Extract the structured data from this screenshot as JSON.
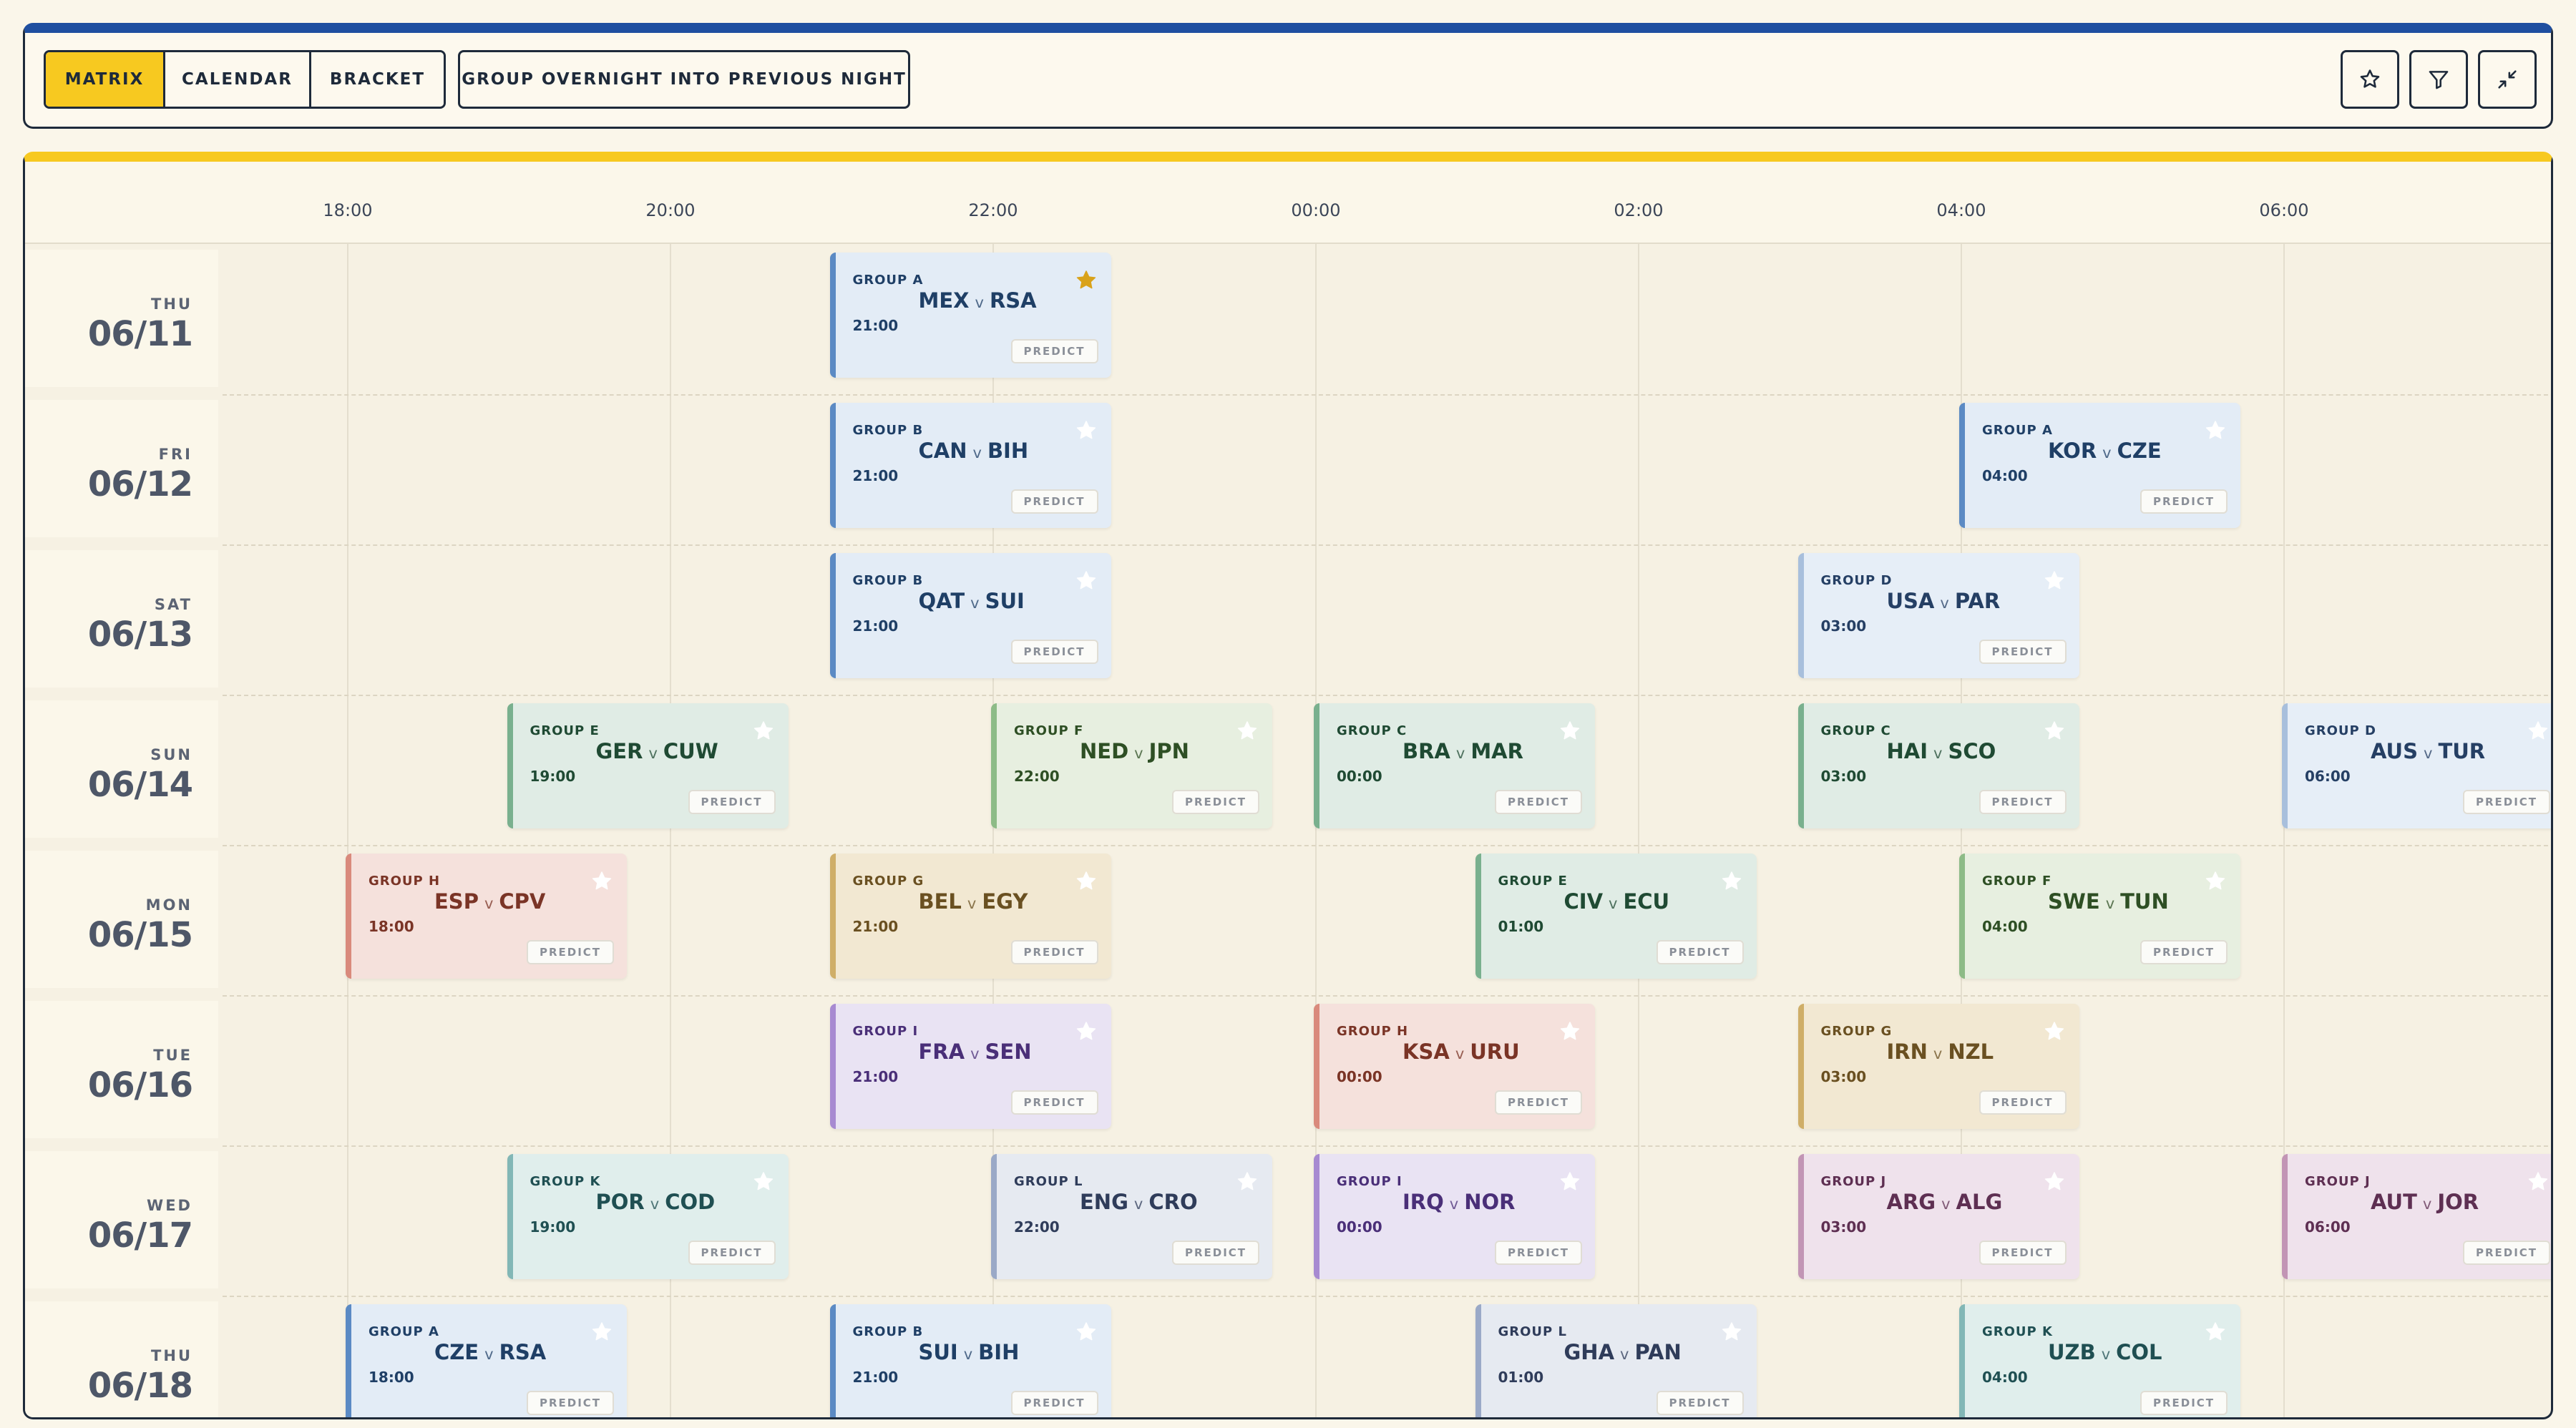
{
  "toolbar": {
    "views": [
      "MATRIX",
      "CALENDAR",
      "BRACKET"
    ],
    "active_view": "MATRIX",
    "group_overnight_label": "GROUP OVERNIGHT INTO PREVIOUS NIGHT",
    "icons": [
      "star-icon",
      "filter-icon",
      "collapse-icon"
    ],
    "colors": {
      "active": "#f7c920",
      "top_accent": "#1f4fa0",
      "panel_accent": "#f7c920"
    }
  },
  "matrix": {
    "time_ticks": [
      "18:00",
      "20:00",
      "22:00",
      "00:00",
      "02:00",
      "04:00",
      "06:00"
    ],
    "days": [
      {
        "dow": "THU",
        "date": "06/11"
      },
      {
        "dow": "FRI",
        "date": "06/12"
      },
      {
        "dow": "SAT",
        "date": "06/13"
      },
      {
        "dow": "SUN",
        "date": "06/14"
      },
      {
        "dow": "MON",
        "date": "06/15"
      },
      {
        "dow": "TUE",
        "date": "06/16"
      },
      {
        "dow": "WED",
        "date": "06/17"
      },
      {
        "dow": "THU",
        "date": "06/18"
      }
    ],
    "predict_label": "PREDICT",
    "vs_label": "v",
    "matches": [
      {
        "day": 0,
        "group": "GROUP A",
        "home": "MEX",
        "away": "RSA",
        "time": "21:00",
        "starred": true,
        "color": "blue"
      },
      {
        "day": 1,
        "group": "GROUP B",
        "home": "CAN",
        "away": "BIH",
        "time": "21:00",
        "starred": false,
        "color": "blue"
      },
      {
        "day": 1,
        "group": "GROUP A",
        "home": "KOR",
        "away": "CZE",
        "time": "04:00",
        "starred": false,
        "color": "blue"
      },
      {
        "day": 2,
        "group": "GROUP B",
        "home": "QAT",
        "away": "SUI",
        "time": "21:00",
        "starred": false,
        "color": "blue"
      },
      {
        "day": 2,
        "group": "GROUP D",
        "home": "USA",
        "away": "PAR",
        "time": "03:00",
        "starred": false,
        "color": "ice"
      },
      {
        "day": 3,
        "group": "GROUP E",
        "home": "GER",
        "away": "CUW",
        "time": "19:00",
        "starred": false,
        "color": "green"
      },
      {
        "day": 3,
        "group": "GROUP F",
        "home": "NED",
        "away": "JPN",
        "time": "22:00",
        "starred": false,
        "color": "lgreen"
      },
      {
        "day": 3,
        "group": "GROUP C",
        "home": "BRA",
        "away": "MAR",
        "time": "00:00",
        "starred": false,
        "color": "green"
      },
      {
        "day": 3,
        "group": "GROUP C",
        "home": "HAI",
        "away": "SCO",
        "time": "03:00",
        "starred": false,
        "color": "green"
      },
      {
        "day": 3,
        "group": "GROUP D",
        "home": "AUS",
        "away": "TUR",
        "time": "06:00",
        "starred": false,
        "color": "ice"
      },
      {
        "day": 4,
        "group": "GROUP H",
        "home": "ESP",
        "away": "CPV",
        "time": "18:00",
        "starred": false,
        "color": "red"
      },
      {
        "day": 4,
        "group": "GROUP G",
        "home": "BEL",
        "away": "EGY",
        "time": "21:00",
        "starred": false,
        "color": "gold"
      },
      {
        "day": 4,
        "group": "GROUP E",
        "home": "CIV",
        "away": "ECU",
        "time": "01:00",
        "starred": false,
        "color": "green"
      },
      {
        "day": 4,
        "group": "GROUP F",
        "home": "SWE",
        "away": "TUN",
        "time": "04:00",
        "starred": false,
        "color": "lgreen"
      },
      {
        "day": 5,
        "group": "GROUP I",
        "home": "FRA",
        "away": "SEN",
        "time": "21:00",
        "starred": false,
        "color": "purple"
      },
      {
        "day": 5,
        "group": "GROUP H",
        "home": "KSA",
        "away": "URU",
        "time": "00:00",
        "starred": false,
        "color": "red"
      },
      {
        "day": 5,
        "group": "GROUP G",
        "home": "IRN",
        "away": "NZL",
        "time": "03:00",
        "starred": false,
        "color": "gold"
      },
      {
        "day": 6,
        "group": "GROUP K",
        "home": "POR",
        "away": "COD",
        "time": "19:00",
        "starred": false,
        "color": "teal"
      },
      {
        "day": 6,
        "group": "GROUP L",
        "home": "ENG",
        "away": "CRO",
        "time": "22:00",
        "starred": false,
        "color": "slate"
      },
      {
        "day": 6,
        "group": "GROUP I",
        "home": "IRQ",
        "away": "NOR",
        "time": "00:00",
        "starred": false,
        "color": "purple"
      },
      {
        "day": 6,
        "group": "GROUP J",
        "home": "ARG",
        "away": "ALG",
        "time": "03:00",
        "starred": false,
        "color": "mauve"
      },
      {
        "day": 6,
        "group": "GROUP J",
        "home": "AUT",
        "away": "JOR",
        "time": "06:00",
        "starred": false,
        "color": "mauve"
      },
      {
        "day": 7,
        "group": "GROUP A",
        "home": "CZE",
        "away": "RSA",
        "time": "18:00",
        "starred": false,
        "color": "blue"
      },
      {
        "day": 7,
        "group": "GROUP B",
        "home": "SUI",
        "away": "BIH",
        "time": "21:00",
        "starred": false,
        "color": "blue"
      },
      {
        "day": 7,
        "group": "GROUP L",
        "home": "GHA",
        "away": "PAN",
        "time": "01:00",
        "starred": false,
        "color": "slate"
      },
      {
        "day": 7,
        "group": "GROUP K",
        "home": "UZB",
        "away": "COL",
        "time": "04:00",
        "starred": false,
        "color": "teal"
      }
    ]
  }
}
